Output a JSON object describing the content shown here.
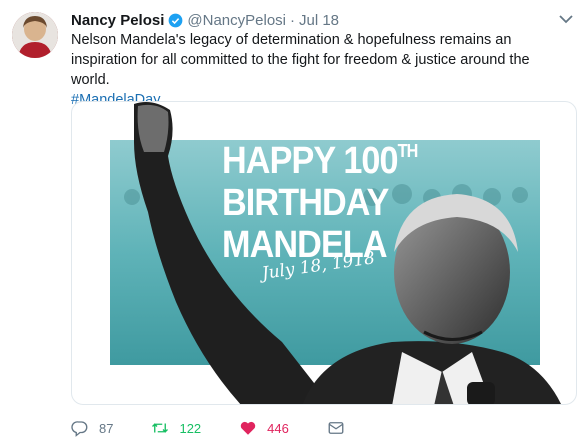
{
  "tweet": {
    "name": "Nancy Pelosi",
    "handle": "@NancyPelosi",
    "separator": "·",
    "date": "Jul 18",
    "text": "Nelson Mandela's legacy of determination & hopefulness remains an inspiration for all committed to the fight for freedom & justice around the world.",
    "hashtag": "#MandelaDay"
  },
  "media": {
    "line1": "HAPPY 100",
    "line1_sup": "TH",
    "line2": "BIRTHDAY",
    "line3": "MANDELA",
    "date_script": "July 18, 1918"
  },
  "actions": {
    "replies": "87",
    "retweets": "122",
    "likes": "446"
  },
  "colors": {
    "link": "#1b6fb3",
    "retweet_active": "#17bf63",
    "like_active": "#e0245e",
    "poster_teal": "#5fb3b8"
  }
}
